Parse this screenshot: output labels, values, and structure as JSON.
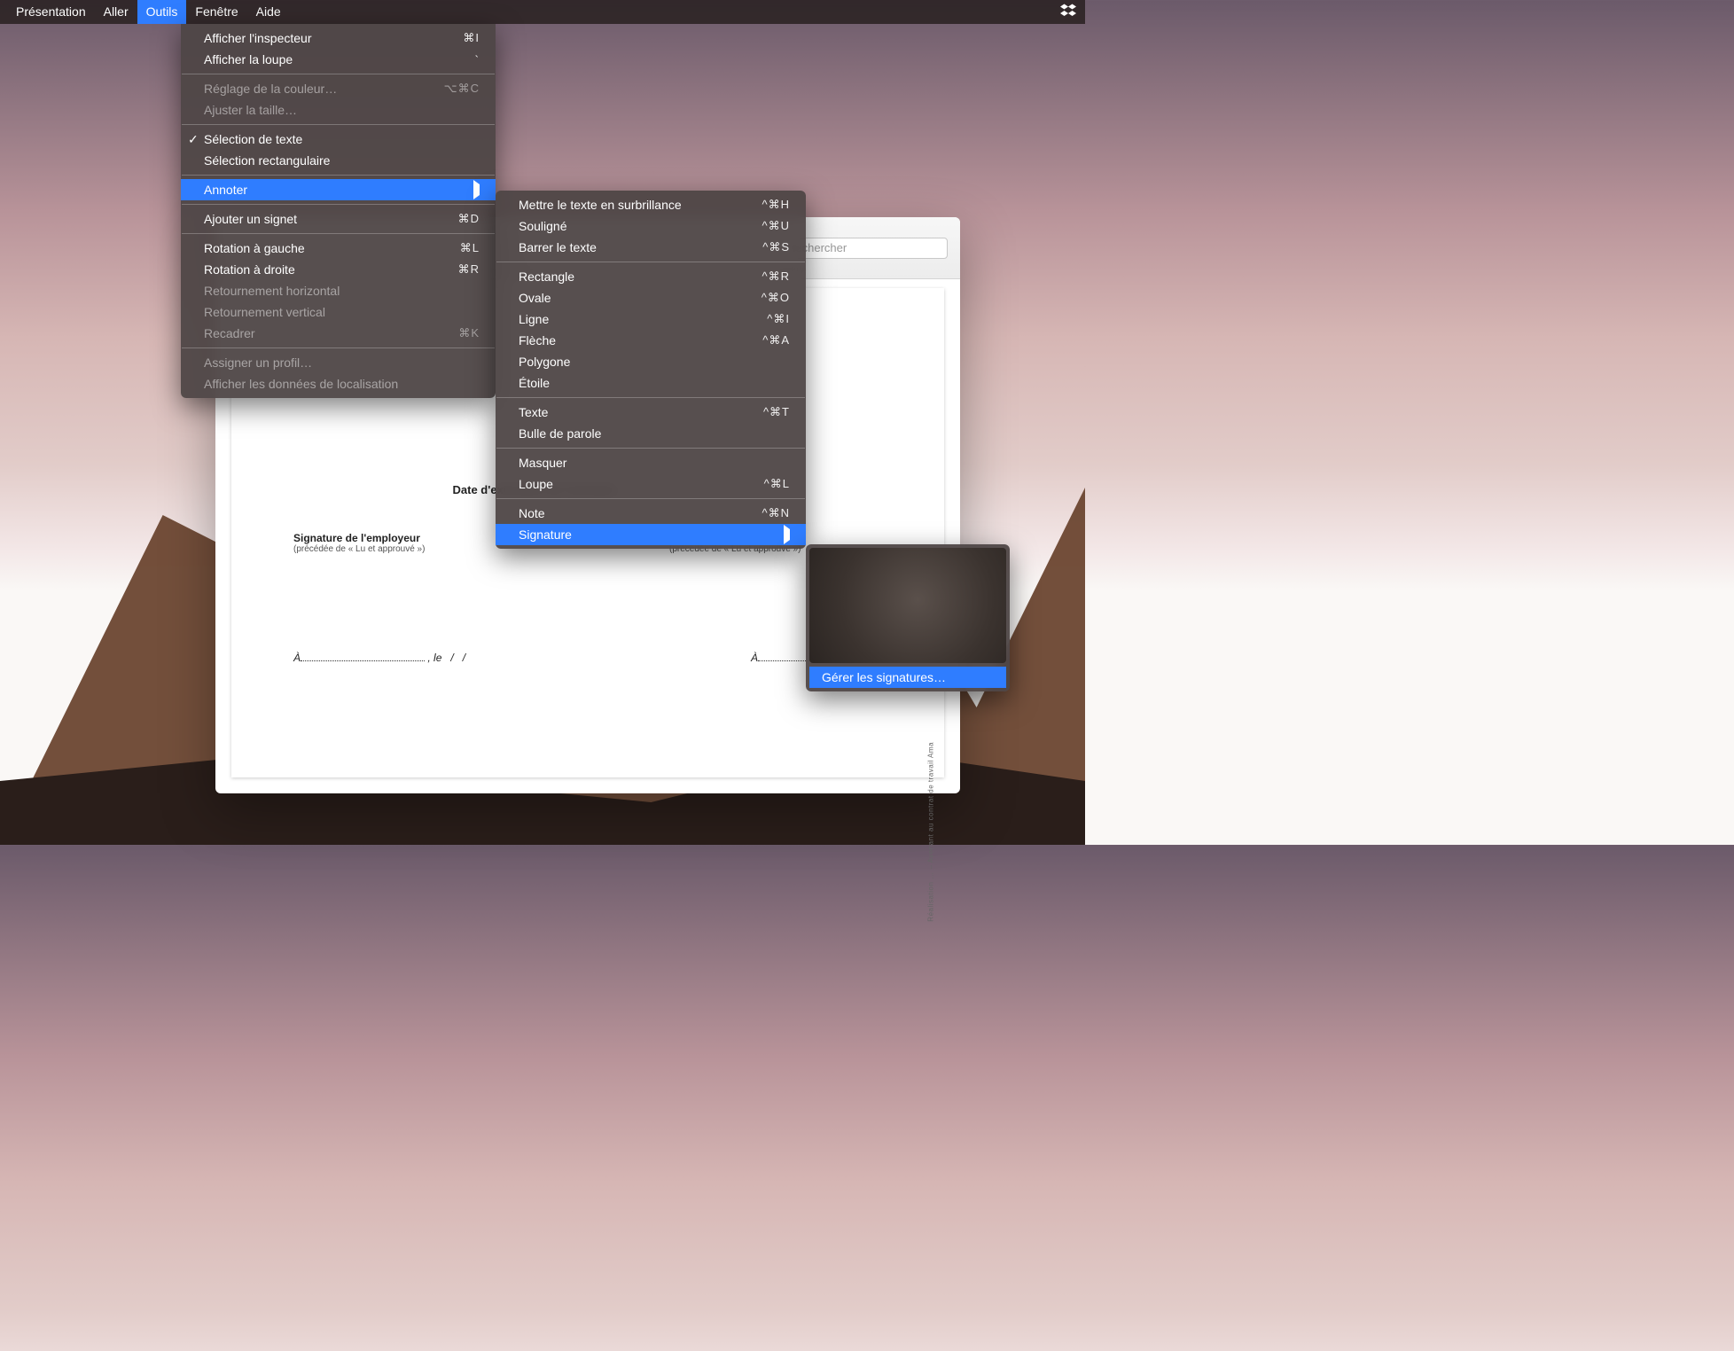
{
  "menubar": {
    "items": [
      {
        "label": "Présentation"
      },
      {
        "label": "Aller"
      },
      {
        "label": "Outils"
      },
      {
        "label": "Fenêtre"
      },
      {
        "label": "Aide"
      }
    ],
    "status_icon": "dropbox-icon"
  },
  "tools_menu": {
    "groups": [
      [
        {
          "label": "Afficher l'inspecteur",
          "shortcut": "⌘I"
        },
        {
          "label": "Afficher la loupe",
          "shortcut": "`"
        }
      ],
      [
        {
          "label": "Réglage de la couleur…",
          "shortcut": "⌥⌘C",
          "disabled": true
        },
        {
          "label": "Ajuster la taille…",
          "disabled": true
        }
      ],
      [
        {
          "label": "Sélection de texte",
          "checked": true
        },
        {
          "label": "Sélection rectangulaire"
        }
      ],
      [
        {
          "label": "Annoter",
          "submenu": true,
          "highlighted": true
        }
      ],
      [
        {
          "label": "Ajouter un signet",
          "shortcut": "⌘D"
        }
      ],
      [
        {
          "label": "Rotation à gauche",
          "shortcut": "⌘L"
        },
        {
          "label": "Rotation à droite",
          "shortcut": "⌘R"
        },
        {
          "label": "Retournement horizontal",
          "disabled": true
        },
        {
          "label": "Retournement vertical",
          "disabled": true
        },
        {
          "label": "Recadrer",
          "shortcut": "⌘K",
          "disabled": true
        }
      ],
      [
        {
          "label": "Assigner un profil…",
          "disabled": true
        },
        {
          "label": "Afficher les données de localisation",
          "disabled": true
        }
      ]
    ]
  },
  "annotate_menu": {
    "groups": [
      [
        {
          "label": "Mettre le texte en surbrillance",
          "shortcut": "^⌘H"
        },
        {
          "label": "Souligné",
          "shortcut": "^⌘U"
        },
        {
          "label": "Barrer le texte",
          "shortcut": "^⌘S"
        }
      ],
      [
        {
          "label": "Rectangle",
          "shortcut": "^⌘R"
        },
        {
          "label": "Ovale",
          "shortcut": "^⌘O"
        },
        {
          "label": "Ligne",
          "shortcut": "^⌘I"
        },
        {
          "label": "Flèche",
          "shortcut": "^⌘A"
        },
        {
          "label": "Polygone"
        },
        {
          "label": "Étoile"
        }
      ],
      [
        {
          "label": "Texte",
          "shortcut": "^⌘T"
        },
        {
          "label": "Bulle de parole"
        }
      ],
      [
        {
          "label": "Masquer"
        },
        {
          "label": "Loupe",
          "shortcut": "^⌘L"
        }
      ],
      [
        {
          "label": "Note",
          "shortcut": "^⌘N"
        },
        {
          "label": "Signature",
          "submenu": true,
          "highlighted": true
        }
      ]
    ]
  },
  "signature_menu": {
    "manage_label": "Gérer les signatures…"
  },
  "window": {
    "search_placeholder": "Rechercher"
  },
  "document": {
    "exec_line_prefix": "Date d'exécution de l'avenant : ",
    "exec_line_sep": " / ",
    "sig_employer": "Signature de l'employeur",
    "sig_sub": "(précédée de « Lu et approuvé »)",
    "sig_sub2": "(précédée de « Lu et approuvé »)",
    "a_letter": "À",
    "le": ", le",
    "slash": "/",
    "side_label": "Réalisation …  – Avenant au contrat de travail Ama"
  }
}
